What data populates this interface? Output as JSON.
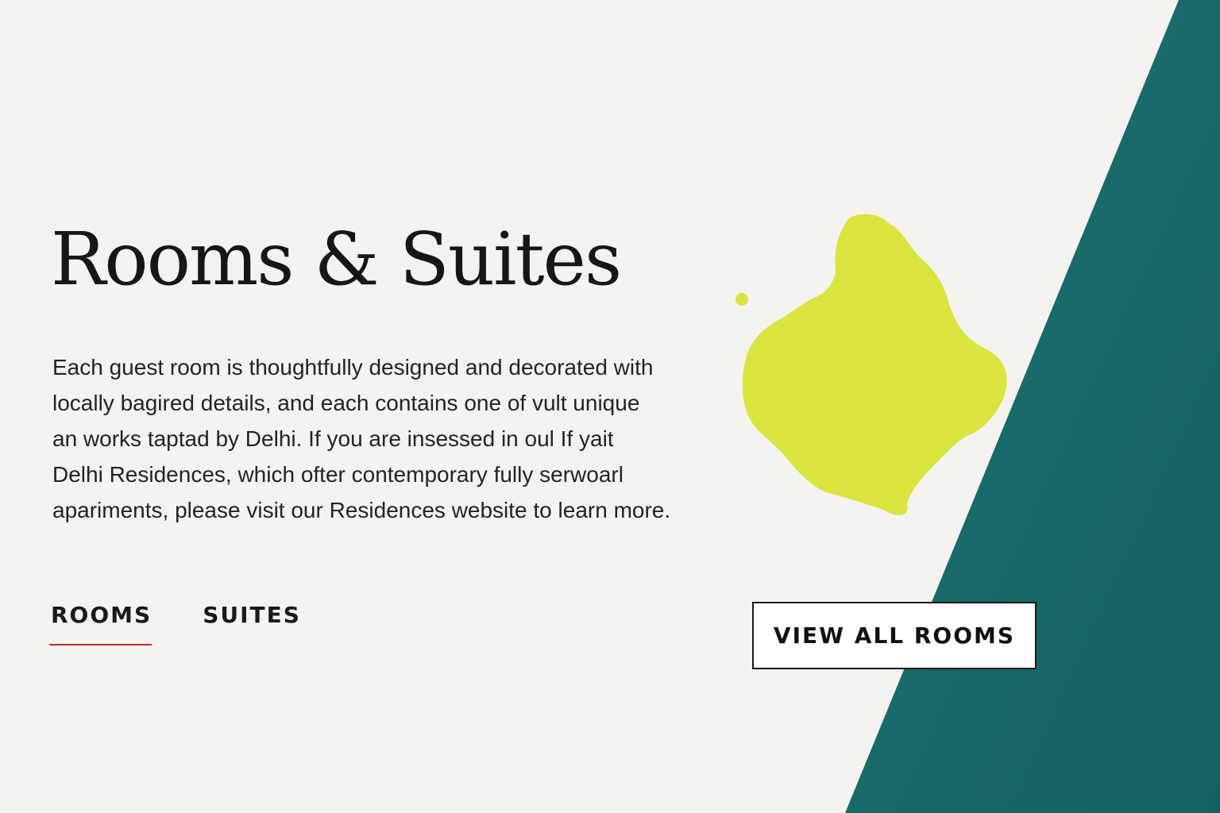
{
  "section": {
    "title": "Rooms & Suites",
    "intro_lines": [
      "Each guest room is thoughtfully designed and decorated with",
      "locally bagired details, and each contains one of vult unique",
      "an works taptad by Delhi. If you are insessed in oul If yait",
      "Delhi Residences, which ofter contemporary fully serwoarl",
      "apariments, please visit our Residences website to learn more."
    ]
  },
  "tabs": [
    {
      "label": "ROOMS",
      "active": true
    },
    {
      "label": "SUITES",
      "active": false
    }
  ],
  "cta": {
    "label": "VIEW ALL ROOMS"
  },
  "colors": {
    "background": "#f4f3ef",
    "teal_band": "#196a6b",
    "blob": "#dbe33f",
    "tab_underline": "#c62828",
    "text": "#1c1c1c"
  }
}
